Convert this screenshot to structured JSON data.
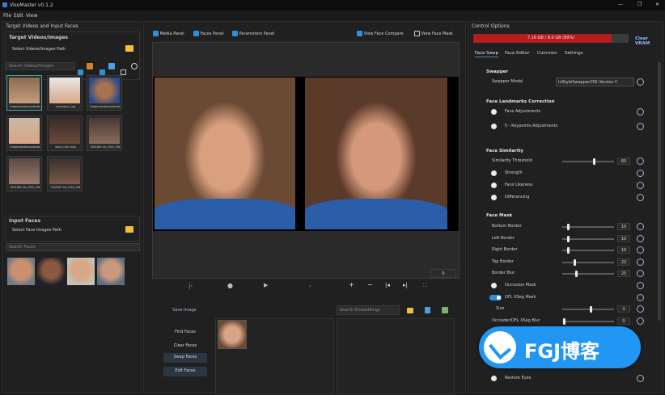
{
  "titlebar": {
    "app_title": "VisoMaster v0.1.2",
    "minimize": "—",
    "maximize": "❐",
    "close": "✕"
  },
  "menu": {
    "items": [
      "File",
      "Edit",
      "View"
    ]
  },
  "left": {
    "section_title": "Target Videos and Input Faces",
    "target_title": "Target Videos/Images",
    "select_target_path": "Select Videos/Images Path",
    "search_target_placeholder": "Search Videos/Images",
    "targets": [
      {
        "caption": "thispersondoesnotexist"
      },
      {
        "caption": "rod-dupixy_.jpg"
      },
      {
        "caption": "thispersondoesnotexist"
      },
      {
        "caption": "thispersondoesnotexist"
      },
      {
        "caption": "stock_clip1.mp4"
      },
      {
        "caption": "3201691-hd_1920_108"
      },
      {
        "caption": "3201691-hd_1920_108"
      },
      {
        "caption": "3169957-hd_1920_108"
      }
    ],
    "input_title": "Input Faces",
    "select_input_path": "Select Face Images Path",
    "search_faces_placeholder": "Search Faces"
  },
  "center": {
    "toggles": {
      "media": "Media Panel",
      "faces": "Faces Panel",
      "params": "Parameters Panel",
      "view_compare": "View Face Compare",
      "view_mask": "View Face Mask"
    },
    "frame_value": "0",
    "save_image": "Save Image",
    "search_embeddings_placeholder": "Search Embeddings",
    "buttons": {
      "find": "Find Faces",
      "clear": "Clear Faces",
      "swap": "Swap Faces",
      "edit": "Edit Faces"
    }
  },
  "right": {
    "title": "Control Options",
    "vram_label": "7.16 GB / 8.0 GB (89%)",
    "vram_fraction": 0.89,
    "clear_vram": "Clear VRAM",
    "tabs": [
      "Face Swap",
      "Face Editor",
      "Common",
      "Settings"
    ],
    "swapper_section": "Swapper",
    "swapper_model_label": "Swapper Model",
    "swapper_model_value": "InStyleSwapper256 Version C",
    "landmarks_section": "Face Landmarks Correction",
    "face_adjustments": "Face Adjustments",
    "keypoints_adjustments": "5 - Keypoints Adjustments",
    "similarity_section": "Face Similarity",
    "similarity_threshold": "Similarity Threshold",
    "similarity_value": "60",
    "strength": "Strength",
    "face_likeness": "Face Likeness",
    "differencing": "Differencing",
    "mask_section": "Face Mask",
    "bottom_border": "Bottom Border",
    "bottom_border_value": "10",
    "left_border": "Left Border",
    "left_border_value": "10",
    "right_border": "Right Border",
    "right_border_value": "10",
    "top_border": "Top Border",
    "top_border_value": "23",
    "border_blur": "Border Blur",
    "border_blur_value": "25",
    "occlusion_mask": "Occlusion Mask",
    "dfl_xseg_mask": "DFL XSeg Mask",
    "size": "Size",
    "size_value": "3",
    "occluder_blur": "Occluder/DFL XSeg Blur",
    "occluder_blur_value": "0",
    "restore_eyes": "Restore Eyes"
  },
  "watermark": {
    "text": "FGJ博客"
  },
  "colors": {
    "accent": "#2f8fd8",
    "vram_bar": "#b51c1c",
    "watermark": "#2196f3"
  }
}
